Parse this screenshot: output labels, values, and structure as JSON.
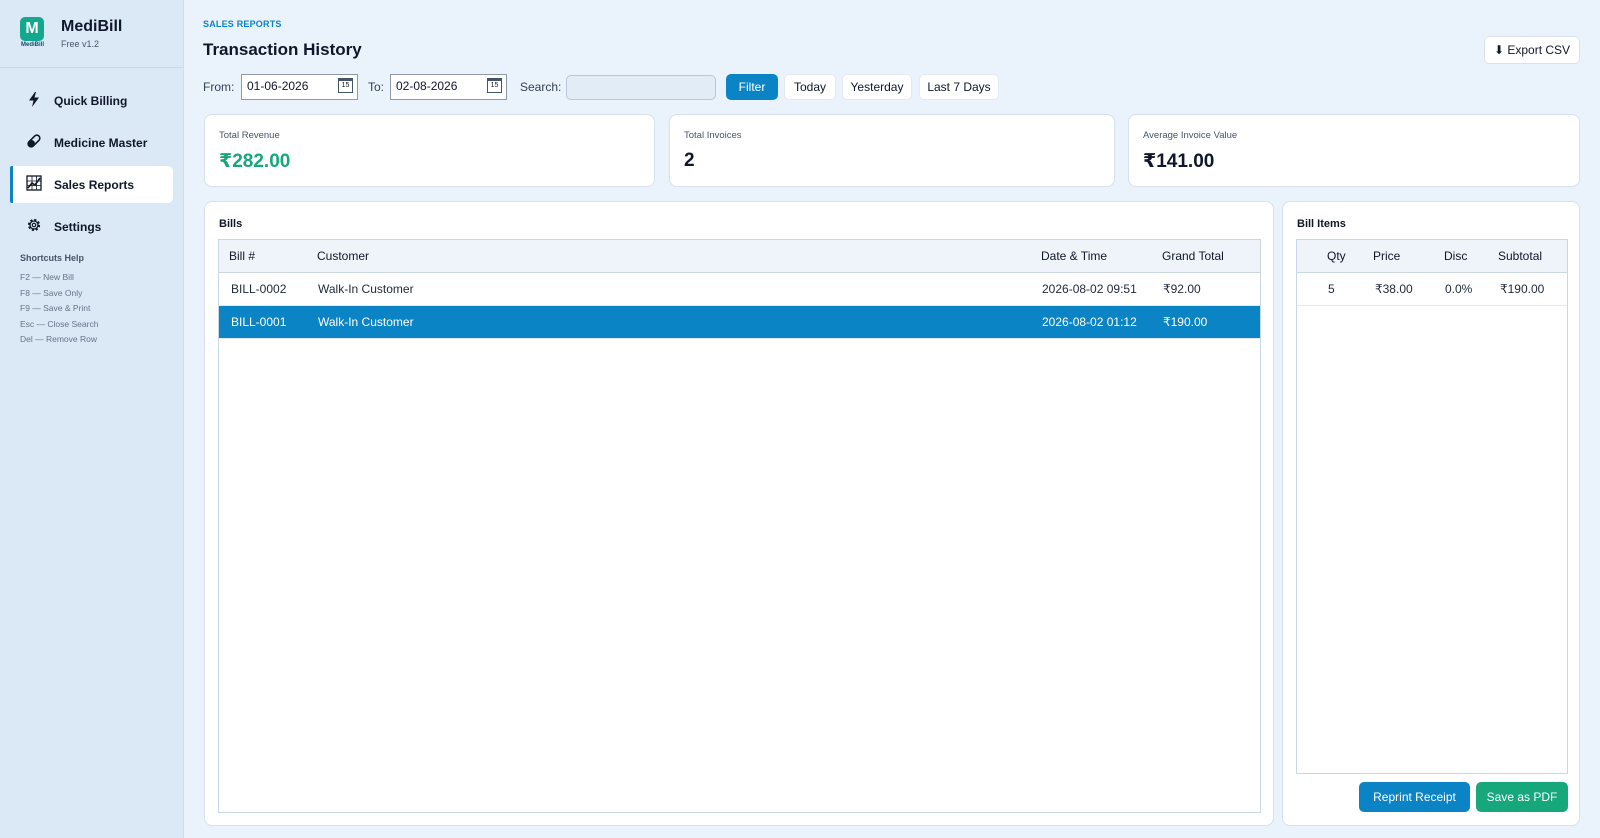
{
  "app": {
    "name": "MediBill",
    "version": "Free v1.2",
    "logo_text": "MediBill",
    "logo_letter": "M"
  },
  "sidebar": {
    "items": [
      {
        "label": "Quick Billing",
        "icon": "bolt-icon"
      },
      {
        "label": "Medicine Master",
        "icon": "pill-icon"
      },
      {
        "label": "Sales Reports",
        "icon": "chart-icon",
        "active": true
      },
      {
        "label": "Settings",
        "icon": "gear-icon"
      }
    ],
    "shortcuts_title": "Shortcuts Help",
    "shortcuts": [
      "F2  — New Bill",
      "F8  — Save Only",
      "F9  — Save & Print",
      "Esc — Close Search",
      "Del — Remove Row"
    ]
  },
  "header": {
    "breadcrumb": "SALES REPORTS",
    "title": "Transaction History",
    "export_label": "⬇ Export CSV"
  },
  "filters": {
    "from_label": "From:",
    "from_value": "01-06-2026",
    "to_label": "To:",
    "to_value": "02-08-2026",
    "search_label": "Search:",
    "search_value": "",
    "calendar_glyph": "15",
    "filter_label": "Filter",
    "today_label": "Today",
    "yesterday_label": "Yesterday",
    "last7_label": "Last 7 Days"
  },
  "stats": {
    "revenue_label": "Total Revenue",
    "revenue_value": "₹282.00",
    "invoices_label": "Total Invoices",
    "invoices_value": "2",
    "avg_label": "Average Invoice Value",
    "avg_value": "₹141.00"
  },
  "bills": {
    "title": "Bills",
    "columns": [
      "Bill #",
      "Customer",
      "Date & Time",
      "Grand Total"
    ],
    "rows": [
      {
        "bill": "BILL-0002",
        "customer": "Walk-In Customer",
        "datetime": "2026-08-02 09:51",
        "total": "₹92.00"
      },
      {
        "bill": "BILL-0001",
        "customer": "Walk-In Customer",
        "datetime": "2026-08-02 01:12",
        "total": "₹190.00",
        "selected": true
      }
    ]
  },
  "bill_items": {
    "title": "Bill Items",
    "columns": [
      "Qty",
      "Price",
      "Disc",
      "Subtotal"
    ],
    "rows": [
      {
        "qty": "5",
        "price": "₹38.00",
        "disc": "0.0%",
        "subtotal": "₹190.00"
      }
    ],
    "reprint_label": "Reprint Receipt",
    "pdf_label": "Save as PDF"
  },
  "colors": {
    "accent": "#0b84c6",
    "success": "#16a77a",
    "sidebar_bg": "#dbe8f6",
    "page_bg": "#eaf2fb"
  }
}
